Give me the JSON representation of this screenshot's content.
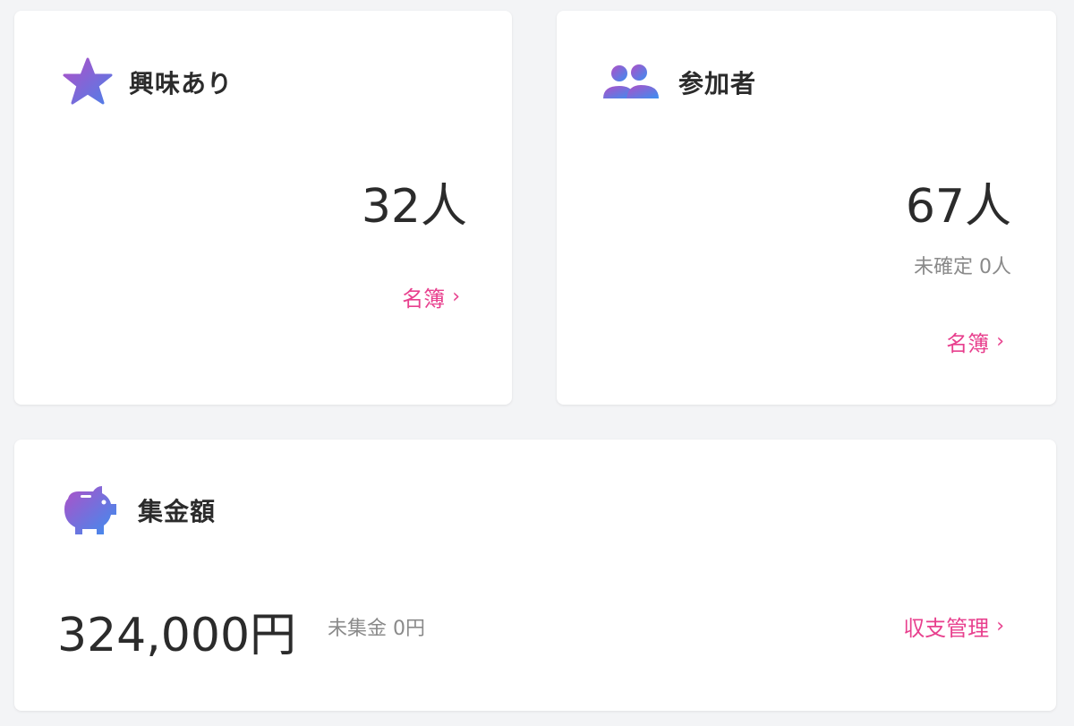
{
  "cards": {
    "interest": {
      "title": "興味あり",
      "icon": "star-icon",
      "count": "32人",
      "link_label": "名簿",
      "link_chevron": "›"
    },
    "participants": {
      "title": "参加者",
      "icon": "people-icon",
      "count": "67人",
      "unconfirmed": "未確定 0人",
      "link_label": "名簿",
      "link_chevron": "›"
    },
    "collection": {
      "title": "集金額",
      "icon": "piggy-bank-icon",
      "amount": "324,000円",
      "uncollected": "未集金 0円",
      "link_label": "収支管理",
      "link_chevron": "›"
    }
  },
  "colors": {
    "accent": "#e8408e",
    "icon_gradient_start": "#b04fc7",
    "icon_gradient_end": "#3b8ff0",
    "background": "#f3f4f6",
    "card": "#ffffff"
  }
}
